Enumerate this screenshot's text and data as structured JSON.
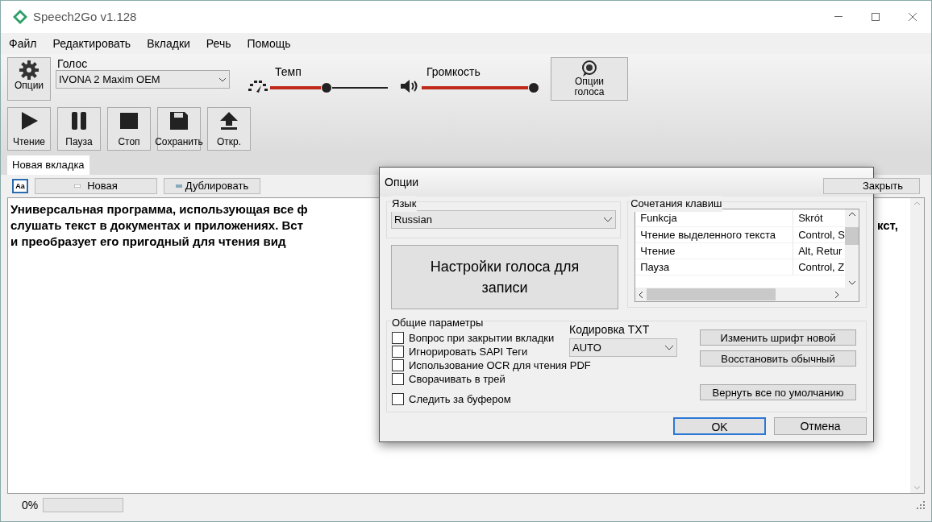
{
  "window": {
    "title": "Speech2Go v1.128"
  },
  "menu": [
    "Файл",
    "Редактировать",
    "Вкладки",
    "Речь",
    "Помощь"
  ],
  "toolbar": {
    "options_button": "Опции",
    "voice": {
      "label": "Голос",
      "value": "IVONA 2 Maxim OEM"
    },
    "tempo": {
      "label": "Темп",
      "level": 0.48
    },
    "volume": {
      "label": "Громкость",
      "level": 1
    },
    "voice_options_button": "Опции голоса"
  },
  "playback_buttons": [
    {
      "kind": "play",
      "label": "Чтение"
    },
    {
      "kind": "pause",
      "label": "Пауза"
    },
    {
      "kind": "stop",
      "label": "Стоп"
    },
    {
      "kind": "save",
      "label": "Сохранить"
    },
    {
      "kind": "open",
      "label": "Откр."
    }
  ],
  "tabs": [
    {
      "label": "Новая вкладка",
      "selected": true
    }
  ],
  "tab_toolbar": {
    "font_button": "Aa",
    "new_button": "Новая",
    "duplicate_button": "Дублировать",
    "close_button": "Закрыть"
  },
  "editor": {
    "lines": [
      {
        "text": "Универсальная программа, использующая все ф"
      },
      {
        "text": "слушать текст в документах и приложениях. Вст",
        "trailing": "кст,"
      },
      {
        "text": "и преобразует его пригодный для чтения вид"
      }
    ]
  },
  "status_bar": {
    "progress_text": "0%",
    "level": 0
  },
  "dialog": {
    "title": "Опции",
    "language": {
      "label": "Язык",
      "value": "Russian"
    },
    "voice_settings_button": "Настройки голоса для записи",
    "shortcuts": {
      "label": "Сочетания клавиш",
      "columns": [
        "Funkcja",
        "Skrót"
      ],
      "rows": [
        [
          "Чтение выделенного текста",
          "Control, S"
        ],
        [
          "Чтение",
          "Alt, Retur"
        ],
        [
          "Пауза",
          "Control, Z"
        ]
      ]
    },
    "general": {
      "label": "Общие параметры",
      "checkboxes": [
        {
          "label": "Вопрос при закрытии вкладки",
          "checked": false
        },
        {
          "label": "Игнорировать SAPI Теги",
          "checked": false
        },
        {
          "label": "Использование OCR для чтения PDF",
          "checked": false
        },
        {
          "label": "Сворачивать в трей",
          "checked": false
        },
        {
          "label": "Следить за буфером",
          "checked": false
        }
      ],
      "encoding": {
        "label": "Кодировка TXT",
        "value": "AUTO"
      },
      "buttons": [
        "Изменить шрифт новой",
        "Восстановить обычный",
        "Вернуть все по умолчанию"
      ]
    },
    "ok_button": "OK",
    "cancel_button": "Отмена"
  }
}
